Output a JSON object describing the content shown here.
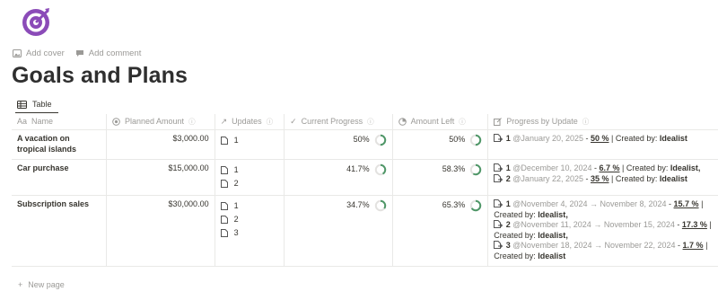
{
  "page": {
    "title": "Goals and Plans",
    "add_cover": "Add cover",
    "add_comment": "Add comment",
    "view_label": "Table",
    "new_page": "New page",
    "icon": "target-icon",
    "accent_color": "#8b4bb8"
  },
  "columns": {
    "name": "Name",
    "planned_amount": "Planned Amount",
    "updates": "Updates",
    "current_progress": "Current Progress",
    "amount_left": "Amount Left",
    "progress_by_update": "Progress by Update"
  },
  "rows": [
    {
      "name": "A vacation on tropical islands",
      "planned_amount": "$3,000.00",
      "updates": [
        "1"
      ],
      "current_progress": "50%",
      "current_progress_value": 0.5,
      "amount_left": "50%",
      "amount_left_value": 0.5,
      "progress": [
        {
          "num": "1",
          "date": "@January 20, 2025",
          "pct": "50 %",
          "by_label": "| Created by:",
          "by": "Idealist",
          "end": ""
        }
      ]
    },
    {
      "name": "Car purchase",
      "planned_amount": "$15,000.00",
      "updates": [
        "1",
        "2"
      ],
      "current_progress": "41.7%",
      "current_progress_value": 0.417,
      "amount_left": "58.3%",
      "amount_left_value": 0.583,
      "progress": [
        {
          "num": "1",
          "date": "@December 10, 2024",
          "pct": "6.7 %",
          "by_label": "| Created by:",
          "by": "Idealist",
          "end": ","
        },
        {
          "num": "2",
          "date": "@January 22, 2025",
          "pct": "35 %",
          "by_label": "| Created by:",
          "by": "Idealist",
          "end": ""
        }
      ]
    },
    {
      "name": "Subscription sales",
      "planned_amount": "$30,000.00",
      "updates": [
        "1",
        "2",
        "3"
      ],
      "current_progress": "34.7%",
      "current_progress_value": 0.347,
      "amount_left": "65.3%",
      "amount_left_value": 0.653,
      "progress": [
        {
          "num": "1",
          "date": "@November 4, 2024 → November 8, 2024",
          "pct": "15.7 %",
          "by_label": "| Created by:",
          "by": "Idealist",
          "end": ","
        },
        {
          "num": "2",
          "date": "@November 11, 2024 → November 15, 2024",
          "pct": "17.3 %",
          "by_label": "| Created by:",
          "by": "Idealist",
          "end": ","
        },
        {
          "num": "3",
          "date": "@November 18, 2024 → November 22, 2024",
          "pct": "1.7 %",
          "by_label": "| Created by:",
          "by": "Idealist",
          "end": ""
        }
      ]
    }
  ],
  "colors": {
    "ring_fill": "#4f9768",
    "ring_track": "#e3e2e0",
    "muted_text": "#9b9a97"
  }
}
